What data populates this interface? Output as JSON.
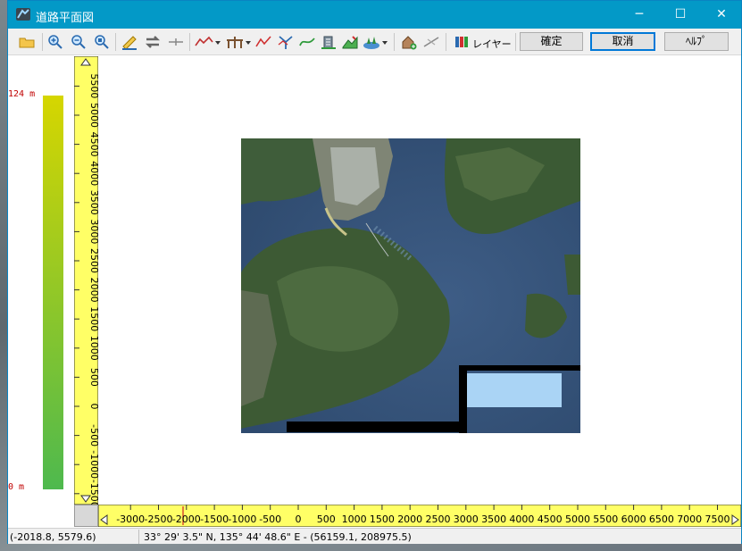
{
  "window": {
    "title": "道路平面図"
  },
  "window_controls": {
    "minimize": "─",
    "maximize": "☐",
    "close": "✕"
  },
  "toolbar": {
    "tools": [
      {
        "name": "open-icon"
      },
      {
        "name": "zoom-in-icon"
      },
      {
        "name": "zoom-out-icon"
      },
      {
        "name": "zoom-fit-icon"
      },
      {
        "name": "ruler-icon"
      },
      {
        "name": "swap-icon"
      },
      {
        "name": "axis-icon"
      },
      {
        "name": "line-menu-icon"
      },
      {
        "name": "bridge-menu-icon"
      },
      {
        "name": "polyline-icon"
      },
      {
        "name": "branch-icon"
      },
      {
        "name": "curve-icon"
      },
      {
        "name": "building-icon"
      },
      {
        "name": "terrain-icon"
      },
      {
        "name": "trees-menu-icon"
      },
      {
        "name": "add-house-icon"
      },
      {
        "name": "scissors-line-icon"
      },
      {
        "name": "layers-icon"
      }
    ],
    "layer_label": "レイヤー",
    "ok_label": "確定",
    "cancel_label": "取消",
    "help_label": "ﾍﾙﾌﾟ"
  },
  "elevation": {
    "max_label": "124 m",
    "min_label": "0 m",
    "max": 124,
    "min": 0,
    "colors": [
      "#d6d600",
      "#4eb94e"
    ]
  },
  "vertical_ruler": {
    "ticks": [
      "5500",
      "5000",
      "4500",
      "4000",
      "3500",
      "3000",
      "2500",
      "2000",
      "1500",
      "1000",
      "500",
      "0",
      "-500",
      "-1000",
      "-1500"
    ]
  },
  "horizontal_ruler": {
    "ticks": [
      "-3000",
      "-2500",
      "-2000",
      "-1500",
      "-1000",
      "-500",
      "0",
      "500",
      "1000",
      "1500",
      "2000",
      "2500",
      "3000",
      "3500",
      "4000",
      "4500",
      "5000",
      "5500",
      "6000",
      "6500",
      "7000",
      "7500"
    ]
  },
  "status": {
    "cursor_coords": "(-2018.8, 5579.6)",
    "geo_coords": "33° 29' 3.5\" N, 135° 44' 48.6\" E  -  (56159.1, 208975.5)"
  },
  "colors": {
    "accent": "#0399c7",
    "ruler": "#ffff66",
    "selection": "#aad4f5"
  }
}
